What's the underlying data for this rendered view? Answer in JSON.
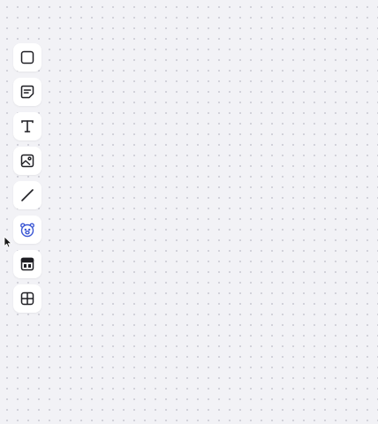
{
  "toolbar": {
    "items": [
      {
        "id": "shape",
        "icon": "square-icon",
        "tooltip": ""
      },
      {
        "id": "sticky-note",
        "icon": "sticky-note-icon",
        "tooltip": ""
      },
      {
        "id": "text",
        "icon": "text-icon",
        "tooltip": ""
      },
      {
        "id": "image",
        "icon": "image-icon",
        "tooltip": ""
      },
      {
        "id": "line",
        "icon": "line-icon",
        "tooltip": ""
      },
      {
        "id": "bear",
        "icon": "bear-icon",
        "tooltip": ""
      },
      {
        "id": "template",
        "icon": "template-icon",
        "tooltip": ""
      },
      {
        "id": "table",
        "icon": "table-grid-icon",
        "tooltip": ""
      }
    ]
  },
  "colors": {
    "canvas_bg": "#f2f2f6",
    "dot": "#c9c9d2",
    "icon": "#1f1f24",
    "accent_bear": "#3a56d4",
    "button_bg": "#ffffff"
  }
}
